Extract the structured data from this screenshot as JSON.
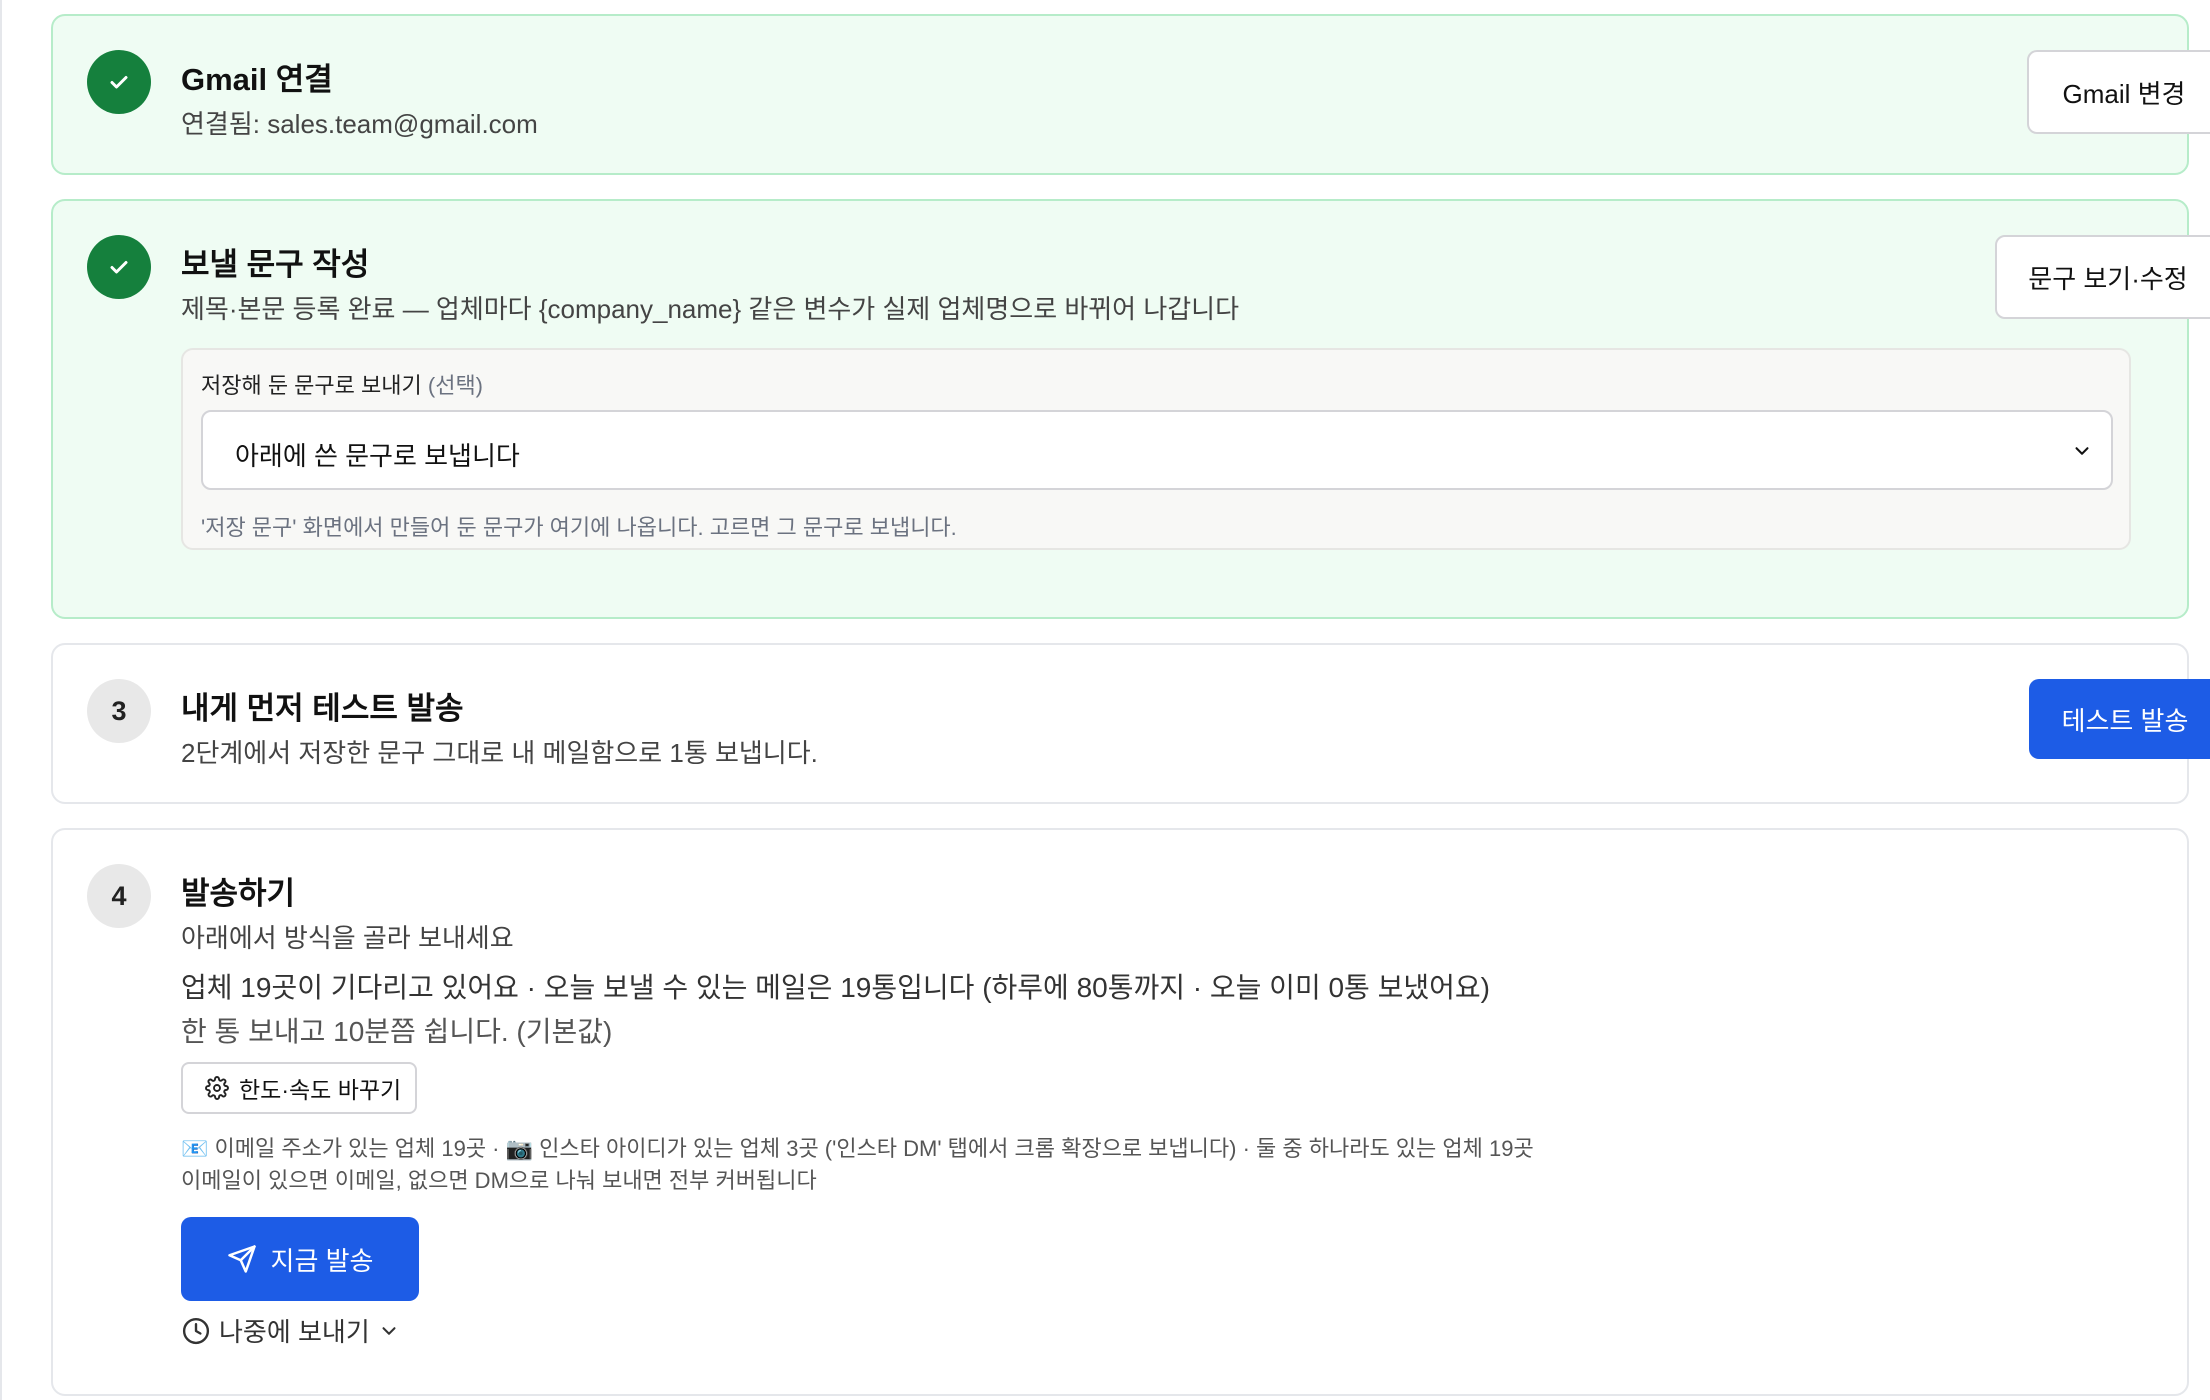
{
  "steps": {
    "gmail": {
      "title": "Gmail 연결",
      "desc": "연결됨: sales.team@gmail.com",
      "button": "Gmail 변경"
    },
    "compose": {
      "title": "보낼 문구 작성",
      "desc": "제목·본문 등록 완료 — 업체마다 {company_name} 같은 변수가 실제 업체명으로 바뀌어 나갑니다",
      "button": "문구 보기·수정",
      "saved_label": "저장해 둔 문구로 보내기",
      "saved_optional": "(선택)",
      "select_value": "아래에 쓴 문구로 보냅니다",
      "hint": "'저장 문구' 화면에서 만들어 둔 문구가 여기에 나옵니다. 고르면 그 문구로 보냅니다."
    },
    "test": {
      "number": "3",
      "title": "내게 먼저 테스트 발송",
      "desc": "2단계에서 저장한 문구 그대로 내 메일함으로 1통 보냅니다.",
      "button": "테스트 발송"
    },
    "send": {
      "number": "4",
      "title": "발송하기",
      "desc": "아래에서 방식을 골라 보내세요",
      "summary": "업체 19곳이 기다리고 있어요 · 오늘 보낼 수 있는 메일은 19통입니다 (하루에 80통까지 · 오늘 이미 0통 보냈어요)",
      "interval": "한 통 보내고 10분쯤 쉽니다. (기본값)",
      "limit_button": "한도·속도 바꾸기",
      "channels": "📧 이메일 주소가 있는 업체 19곳 · 📷 인스타 아이디가 있는 업체 3곳 ('인스타 DM' 탭에서 크롬 확장으로 보냅니다) · 둘 중 하나라도 있는 업체 19곳",
      "coverage": "이메일이 있으면 이메일, 없으면 DM으로 나눠 보내면 전부 커버됩니다",
      "send_now": "지금 발송",
      "send_later": "나중에 보내기"
    }
  },
  "colors": {
    "done_bg": "#effcf3",
    "done_border": "#b6ecc9",
    "check_green": "#15803d",
    "primary": "#1d5ce6"
  },
  "icons": {
    "step_done": "check-icon",
    "settings": "gear-icon",
    "send": "paper-plane-icon",
    "schedule": "clock-icon",
    "dropdown": "chevron-down-icon"
  }
}
